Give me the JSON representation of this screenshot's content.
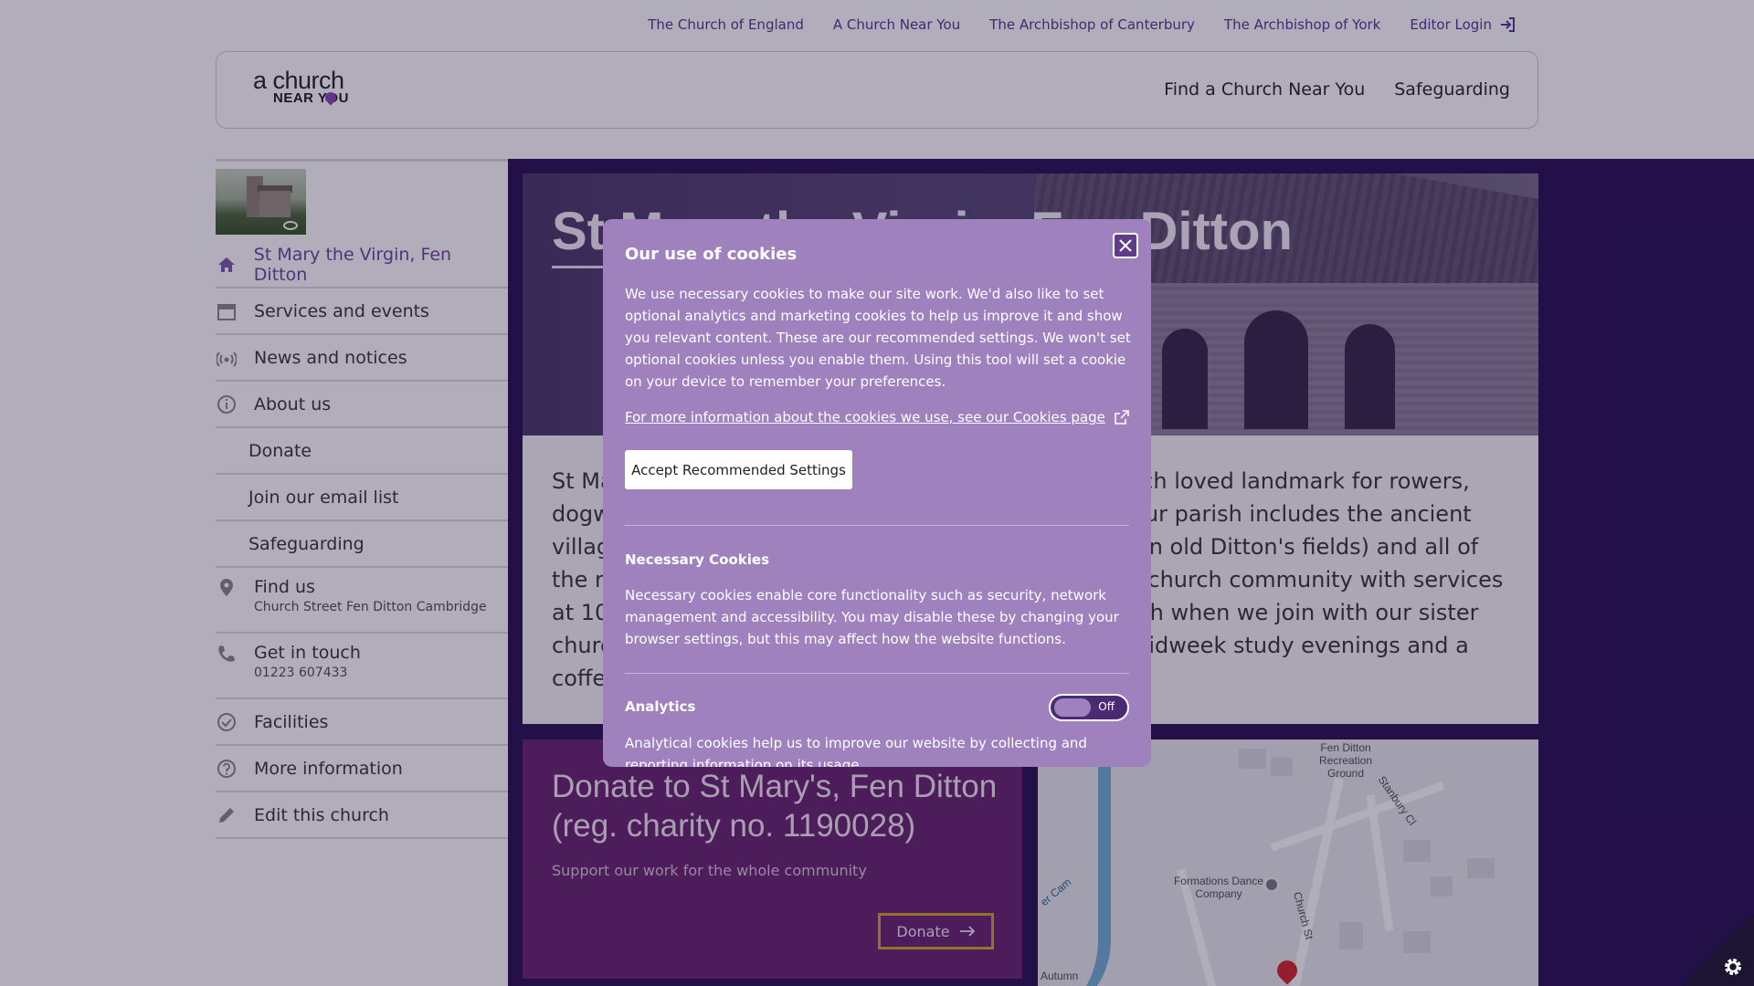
{
  "top_links": [
    {
      "label": "The Church of England"
    },
    {
      "label": "A Church Near You"
    },
    {
      "label": "The Archbishop of Canterbury"
    },
    {
      "label": "The Archbishop of York"
    },
    {
      "label": "Editor Login",
      "icon": "login-icon"
    }
  ],
  "logo": {
    "line1": "a church",
    "line2": "NEAR YOU"
  },
  "main_nav": [
    {
      "label": "Find a Church Near You"
    },
    {
      "label": "Safeguarding"
    }
  ],
  "sidebar": {
    "items": [
      {
        "label": "St Mary the Virgin, Fen Ditton",
        "icon": "home-icon",
        "active": true
      },
      {
        "label": "Services and events",
        "icon": "calendar-icon"
      },
      {
        "label": "News and notices",
        "icon": "broadcast-icon"
      },
      {
        "label": "About us",
        "icon": "info-icon"
      },
      {
        "label": "Donate"
      },
      {
        "label": "Join our email list"
      },
      {
        "label": "Safeguarding"
      },
      {
        "label": "Find us",
        "sublabel": "Church Street Fen Ditton Cambridge",
        "icon": "location-pin-icon"
      },
      {
        "label": "Get in touch",
        "sublabel": "01223 607433",
        "icon": "phone-icon"
      },
      {
        "label": "Facilities",
        "icon": "check-circle-icon"
      },
      {
        "label": "More information",
        "icon": "question-circle-icon"
      },
      {
        "label": "Edit this church",
        "icon": "pencil-icon"
      }
    ]
  },
  "hero": {
    "title": "St Mary the Virgin, Fen Ditton"
  },
  "description": {
    "left_lines": [
      "St Ma",
      "dogw",
      "villag",
      "the n",
      "at 10",
      "churc",
      "coffe"
    ],
    "right_lines": [
      "uch loved landmark for rowers,",
      "Our parish includes the ancient",
      "t in old Ditton's fields) and all of",
      "e church community with services",
      "nth when we join with our sister",
      "midweek study evenings and a",
      ""
    ]
  },
  "donate": {
    "title": "Donate to St Mary's, Fen Ditton (reg. charity no. 1190028)",
    "subtitle": "Support our work for the whole community",
    "button_label": "Donate"
  },
  "map": {
    "labels": [
      "Fen Ditton Recreation Ground",
      "Stanbury Cl",
      "Formations Dance Company",
      "Church St",
      "er Cam",
      "Autumn"
    ]
  },
  "cookie_modal": {
    "title": "Our use of cookies",
    "body": "We use necessary cookies to make our site work. We'd also like to set optional analytics and marketing cookies to help us improve it and show you relevant content. These are our recommended settings. We won't set optional cookies unless you enable them. Using this tool will set a cookie on your device to remember your preferences.",
    "more_info_link": "For more information about the cookies we use, see our Cookies page",
    "accept_button": "Accept Recommended Settings",
    "necessary": {
      "heading": "Necessary Cookies",
      "text": "Necessary cookies enable core functionality such as security, network management and accessibility. You may disable these by changing your browser settings, but this may affect how the website functions."
    },
    "analytics": {
      "heading": "Analytics",
      "toggle_state": "Off",
      "text": "Analytical cookies help us to improve our website by collecting and reporting information on its usage."
    }
  },
  "colors": {
    "brand_purple": "#5b3d94",
    "main_bg": "#2e1958",
    "modal_bg": "#9f82bd",
    "donate_bg": "#6c2a73",
    "donate_border": "#d6a72a"
  }
}
